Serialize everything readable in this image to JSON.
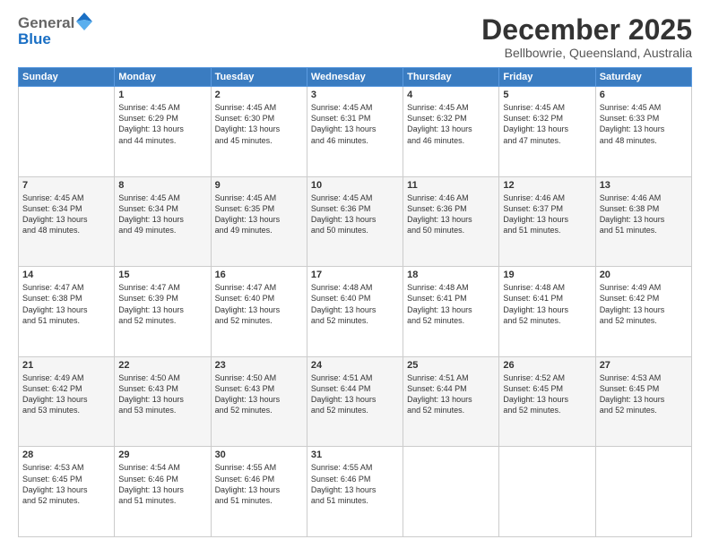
{
  "header": {
    "logo_line1": "General",
    "logo_line2": "Blue",
    "month": "December 2025",
    "location": "Bellbowrie, Queensland, Australia"
  },
  "weekdays": [
    "Sunday",
    "Monday",
    "Tuesday",
    "Wednesday",
    "Thursday",
    "Friday",
    "Saturday"
  ],
  "weeks": [
    [
      {
        "day": "",
        "empty": true
      },
      {
        "day": "1",
        "sunrise": "Sunrise: 4:45 AM",
        "sunset": "Sunset: 6:29 PM",
        "daylight": "Daylight: 13 hours and 44 minutes."
      },
      {
        "day": "2",
        "sunrise": "Sunrise: 4:45 AM",
        "sunset": "Sunset: 6:30 PM",
        "daylight": "Daylight: 13 hours and 45 minutes."
      },
      {
        "day": "3",
        "sunrise": "Sunrise: 4:45 AM",
        "sunset": "Sunset: 6:31 PM",
        "daylight": "Daylight: 13 hours and 46 minutes."
      },
      {
        "day": "4",
        "sunrise": "Sunrise: 4:45 AM",
        "sunset": "Sunset: 6:32 PM",
        "daylight": "Daylight: 13 hours and 46 minutes."
      },
      {
        "day": "5",
        "sunrise": "Sunrise: 4:45 AM",
        "sunset": "Sunset: 6:32 PM",
        "daylight": "Daylight: 13 hours and 47 minutes."
      },
      {
        "day": "6",
        "sunrise": "Sunrise: 4:45 AM",
        "sunset": "Sunset: 6:33 PM",
        "daylight": "Daylight: 13 hours and 48 minutes."
      }
    ],
    [
      {
        "day": "7",
        "sunrise": "Sunrise: 4:45 AM",
        "sunset": "Sunset: 6:34 PM",
        "daylight": "Daylight: 13 hours and 48 minutes."
      },
      {
        "day": "8",
        "sunrise": "Sunrise: 4:45 AM",
        "sunset": "Sunset: 6:34 PM",
        "daylight": "Daylight: 13 hours and 49 minutes."
      },
      {
        "day": "9",
        "sunrise": "Sunrise: 4:45 AM",
        "sunset": "Sunset: 6:35 PM",
        "daylight": "Daylight: 13 hours and 49 minutes."
      },
      {
        "day": "10",
        "sunrise": "Sunrise: 4:45 AM",
        "sunset": "Sunset: 6:36 PM",
        "daylight": "Daylight: 13 hours and 50 minutes."
      },
      {
        "day": "11",
        "sunrise": "Sunrise: 4:46 AM",
        "sunset": "Sunset: 6:36 PM",
        "daylight": "Daylight: 13 hours and 50 minutes."
      },
      {
        "day": "12",
        "sunrise": "Sunrise: 4:46 AM",
        "sunset": "Sunset: 6:37 PM",
        "daylight": "Daylight: 13 hours and 51 minutes."
      },
      {
        "day": "13",
        "sunrise": "Sunrise: 4:46 AM",
        "sunset": "Sunset: 6:38 PM",
        "daylight": "Daylight: 13 hours and 51 minutes."
      }
    ],
    [
      {
        "day": "14",
        "sunrise": "Sunrise: 4:47 AM",
        "sunset": "Sunset: 6:38 PM",
        "daylight": "Daylight: 13 hours and 51 minutes."
      },
      {
        "day": "15",
        "sunrise": "Sunrise: 4:47 AM",
        "sunset": "Sunset: 6:39 PM",
        "daylight": "Daylight: 13 hours and 52 minutes."
      },
      {
        "day": "16",
        "sunrise": "Sunrise: 4:47 AM",
        "sunset": "Sunset: 6:40 PM",
        "daylight": "Daylight: 13 hours and 52 minutes."
      },
      {
        "day": "17",
        "sunrise": "Sunrise: 4:48 AM",
        "sunset": "Sunset: 6:40 PM",
        "daylight": "Daylight: 13 hours and 52 minutes."
      },
      {
        "day": "18",
        "sunrise": "Sunrise: 4:48 AM",
        "sunset": "Sunset: 6:41 PM",
        "daylight": "Daylight: 13 hours and 52 minutes."
      },
      {
        "day": "19",
        "sunrise": "Sunrise: 4:48 AM",
        "sunset": "Sunset: 6:41 PM",
        "daylight": "Daylight: 13 hours and 52 minutes."
      },
      {
        "day": "20",
        "sunrise": "Sunrise: 4:49 AM",
        "sunset": "Sunset: 6:42 PM",
        "daylight": "Daylight: 13 hours and 52 minutes."
      }
    ],
    [
      {
        "day": "21",
        "sunrise": "Sunrise: 4:49 AM",
        "sunset": "Sunset: 6:42 PM",
        "daylight": "Daylight: 13 hours and 53 minutes."
      },
      {
        "day": "22",
        "sunrise": "Sunrise: 4:50 AM",
        "sunset": "Sunset: 6:43 PM",
        "daylight": "Daylight: 13 hours and 53 minutes."
      },
      {
        "day": "23",
        "sunrise": "Sunrise: 4:50 AM",
        "sunset": "Sunset: 6:43 PM",
        "daylight": "Daylight: 13 hours and 52 minutes."
      },
      {
        "day": "24",
        "sunrise": "Sunrise: 4:51 AM",
        "sunset": "Sunset: 6:44 PM",
        "daylight": "Daylight: 13 hours and 52 minutes."
      },
      {
        "day": "25",
        "sunrise": "Sunrise: 4:51 AM",
        "sunset": "Sunset: 6:44 PM",
        "daylight": "Daylight: 13 hours and 52 minutes."
      },
      {
        "day": "26",
        "sunrise": "Sunrise: 4:52 AM",
        "sunset": "Sunset: 6:45 PM",
        "daylight": "Daylight: 13 hours and 52 minutes."
      },
      {
        "day": "27",
        "sunrise": "Sunrise: 4:53 AM",
        "sunset": "Sunset: 6:45 PM",
        "daylight": "Daylight: 13 hours and 52 minutes."
      }
    ],
    [
      {
        "day": "28",
        "sunrise": "Sunrise: 4:53 AM",
        "sunset": "Sunset: 6:45 PM",
        "daylight": "Daylight: 13 hours and 52 minutes."
      },
      {
        "day": "29",
        "sunrise": "Sunrise: 4:54 AM",
        "sunset": "Sunset: 6:46 PM",
        "daylight": "Daylight: 13 hours and 51 minutes."
      },
      {
        "day": "30",
        "sunrise": "Sunrise: 4:55 AM",
        "sunset": "Sunset: 6:46 PM",
        "daylight": "Daylight: 13 hours and 51 minutes."
      },
      {
        "day": "31",
        "sunrise": "Sunrise: 4:55 AM",
        "sunset": "Sunset: 6:46 PM",
        "daylight": "Daylight: 13 hours and 51 minutes."
      },
      {
        "day": "",
        "empty": true
      },
      {
        "day": "",
        "empty": true
      },
      {
        "day": "",
        "empty": true
      }
    ]
  ]
}
